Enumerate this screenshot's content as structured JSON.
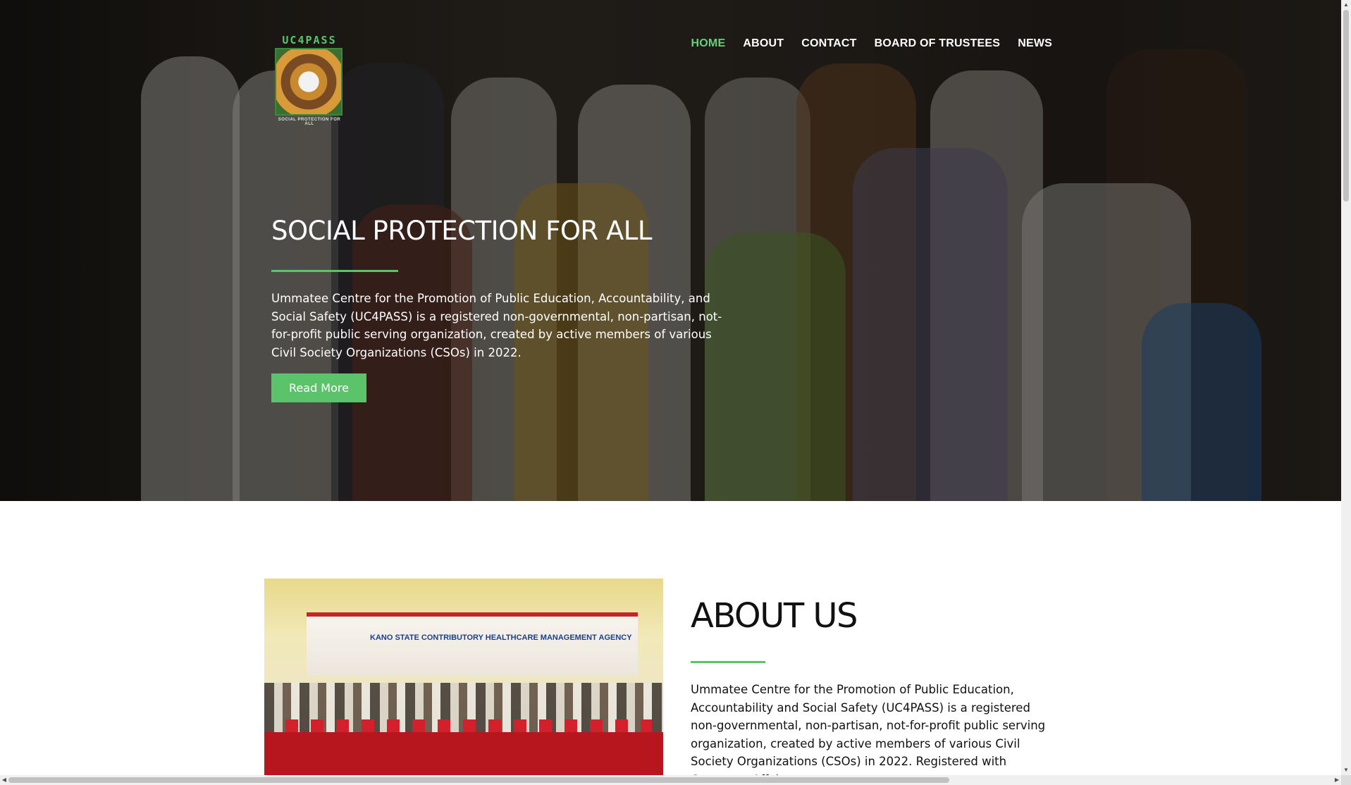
{
  "brand": {
    "logo_top": "UC4PASS",
    "logo_bottom": "SOCIAL PROTECTION FOR ALL"
  },
  "nav": {
    "items": [
      {
        "label": "HOME",
        "active": true
      },
      {
        "label": "ABOUT",
        "active": false
      },
      {
        "label": "CONTACT",
        "active": false
      },
      {
        "label": "BOARD OF TRUSTEES",
        "active": false
      },
      {
        "label": "NEWS",
        "active": false
      }
    ]
  },
  "hero": {
    "title": "SOCIAL PROTECTION FOR ALL",
    "text": "Ummatee Centre for the Promotion of Public Education, Accountability, and Social Safety (UC4PASS) is a registered non-governmental, non-partisan, not-for-profit public serving organization, created by active members of various Civil Society Organizations (CSOs) in 2022.",
    "button_label": "Read More"
  },
  "about": {
    "image_banner_text": "KANO STATE CONTRIBUTORY HEALTHCARE MANAGEMENT AGENCY",
    "title": "ABOUT US",
    "text": "Ummatee Centre for the Promotion of Public Education, Accountability and Social Safety (UC4PASS) is a registered non-governmental, non-partisan, not-for-profit public serving organization, created by active members of various Civil Society Organizations (CSOs) in 2022. Registered with Corporate Affairs"
  },
  "colors": {
    "accent": "#5bc46a",
    "nav_active": "#66d07a",
    "text_dark": "#111111"
  },
  "icons": {
    "scroll_up": "▲",
    "scroll_down": "▼",
    "scroll_left": "◀",
    "scroll_right": "▶"
  }
}
